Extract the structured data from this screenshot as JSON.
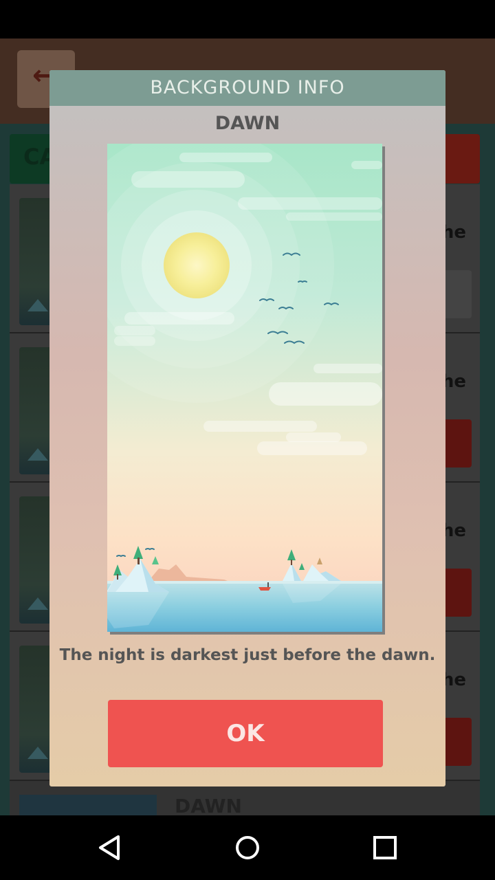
{
  "dialog": {
    "title": "BACKGROUND INFO",
    "background_name": "DAWN",
    "quote": "The night is darkest just before the dawn.",
    "ok_label": "OK"
  },
  "underlying": {
    "category_label": "CA",
    "row_text": "he",
    "bottom_row_title": "DAWN"
  },
  "navbar": {
    "back_icon": "triangle-back-icon",
    "home_icon": "circle-home-icon",
    "recents_icon": "square-recents-icon"
  },
  "colors": {
    "ok_button": "#ef5350",
    "header": "#7d9c93"
  }
}
